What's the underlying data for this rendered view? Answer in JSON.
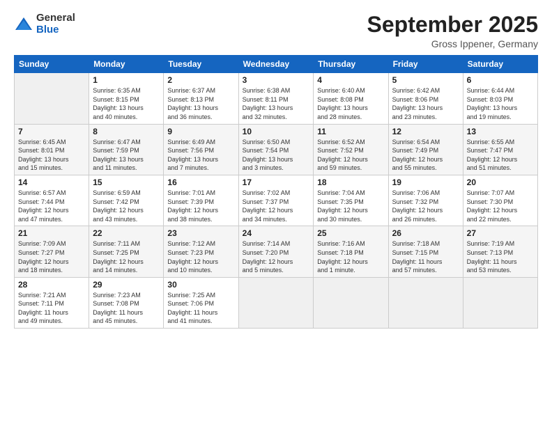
{
  "logo": {
    "general": "General",
    "blue": "Blue"
  },
  "title": "September 2025",
  "subtitle": "Gross Ippener, Germany",
  "headers": [
    "Sunday",
    "Monday",
    "Tuesday",
    "Wednesday",
    "Thursday",
    "Friday",
    "Saturday"
  ],
  "weeks": [
    [
      {
        "day": "",
        "info": ""
      },
      {
        "day": "1",
        "info": "Sunrise: 6:35 AM\nSunset: 8:15 PM\nDaylight: 13 hours\nand 40 minutes."
      },
      {
        "day": "2",
        "info": "Sunrise: 6:37 AM\nSunset: 8:13 PM\nDaylight: 13 hours\nand 36 minutes."
      },
      {
        "day": "3",
        "info": "Sunrise: 6:38 AM\nSunset: 8:11 PM\nDaylight: 13 hours\nand 32 minutes."
      },
      {
        "day": "4",
        "info": "Sunrise: 6:40 AM\nSunset: 8:08 PM\nDaylight: 13 hours\nand 28 minutes."
      },
      {
        "day": "5",
        "info": "Sunrise: 6:42 AM\nSunset: 8:06 PM\nDaylight: 13 hours\nand 23 minutes."
      },
      {
        "day": "6",
        "info": "Sunrise: 6:44 AM\nSunset: 8:03 PM\nDaylight: 13 hours\nand 19 minutes."
      }
    ],
    [
      {
        "day": "7",
        "info": "Sunrise: 6:45 AM\nSunset: 8:01 PM\nDaylight: 13 hours\nand 15 minutes."
      },
      {
        "day": "8",
        "info": "Sunrise: 6:47 AM\nSunset: 7:59 PM\nDaylight: 13 hours\nand 11 minutes."
      },
      {
        "day": "9",
        "info": "Sunrise: 6:49 AM\nSunset: 7:56 PM\nDaylight: 13 hours\nand 7 minutes."
      },
      {
        "day": "10",
        "info": "Sunrise: 6:50 AM\nSunset: 7:54 PM\nDaylight: 13 hours\nand 3 minutes."
      },
      {
        "day": "11",
        "info": "Sunrise: 6:52 AM\nSunset: 7:52 PM\nDaylight: 12 hours\nand 59 minutes."
      },
      {
        "day": "12",
        "info": "Sunrise: 6:54 AM\nSunset: 7:49 PM\nDaylight: 12 hours\nand 55 minutes."
      },
      {
        "day": "13",
        "info": "Sunrise: 6:55 AM\nSunset: 7:47 PM\nDaylight: 12 hours\nand 51 minutes."
      }
    ],
    [
      {
        "day": "14",
        "info": "Sunrise: 6:57 AM\nSunset: 7:44 PM\nDaylight: 12 hours\nand 47 minutes."
      },
      {
        "day": "15",
        "info": "Sunrise: 6:59 AM\nSunset: 7:42 PM\nDaylight: 12 hours\nand 43 minutes."
      },
      {
        "day": "16",
        "info": "Sunrise: 7:01 AM\nSunset: 7:39 PM\nDaylight: 12 hours\nand 38 minutes."
      },
      {
        "day": "17",
        "info": "Sunrise: 7:02 AM\nSunset: 7:37 PM\nDaylight: 12 hours\nand 34 minutes."
      },
      {
        "day": "18",
        "info": "Sunrise: 7:04 AM\nSunset: 7:35 PM\nDaylight: 12 hours\nand 30 minutes."
      },
      {
        "day": "19",
        "info": "Sunrise: 7:06 AM\nSunset: 7:32 PM\nDaylight: 12 hours\nand 26 minutes."
      },
      {
        "day": "20",
        "info": "Sunrise: 7:07 AM\nSunset: 7:30 PM\nDaylight: 12 hours\nand 22 minutes."
      }
    ],
    [
      {
        "day": "21",
        "info": "Sunrise: 7:09 AM\nSunset: 7:27 PM\nDaylight: 12 hours\nand 18 minutes."
      },
      {
        "day": "22",
        "info": "Sunrise: 7:11 AM\nSunset: 7:25 PM\nDaylight: 12 hours\nand 14 minutes."
      },
      {
        "day": "23",
        "info": "Sunrise: 7:12 AM\nSunset: 7:23 PM\nDaylight: 12 hours\nand 10 minutes."
      },
      {
        "day": "24",
        "info": "Sunrise: 7:14 AM\nSunset: 7:20 PM\nDaylight: 12 hours\nand 5 minutes."
      },
      {
        "day": "25",
        "info": "Sunrise: 7:16 AM\nSunset: 7:18 PM\nDaylight: 12 hours\nand 1 minute."
      },
      {
        "day": "26",
        "info": "Sunrise: 7:18 AM\nSunset: 7:15 PM\nDaylight: 11 hours\nand 57 minutes."
      },
      {
        "day": "27",
        "info": "Sunrise: 7:19 AM\nSunset: 7:13 PM\nDaylight: 11 hours\nand 53 minutes."
      }
    ],
    [
      {
        "day": "28",
        "info": "Sunrise: 7:21 AM\nSunset: 7:11 PM\nDaylight: 11 hours\nand 49 minutes."
      },
      {
        "day": "29",
        "info": "Sunrise: 7:23 AM\nSunset: 7:08 PM\nDaylight: 11 hours\nand 45 minutes."
      },
      {
        "day": "30",
        "info": "Sunrise: 7:25 AM\nSunset: 7:06 PM\nDaylight: 11 hours\nand 41 minutes."
      },
      {
        "day": "",
        "info": ""
      },
      {
        "day": "",
        "info": ""
      },
      {
        "day": "",
        "info": ""
      },
      {
        "day": "",
        "info": ""
      }
    ]
  ]
}
